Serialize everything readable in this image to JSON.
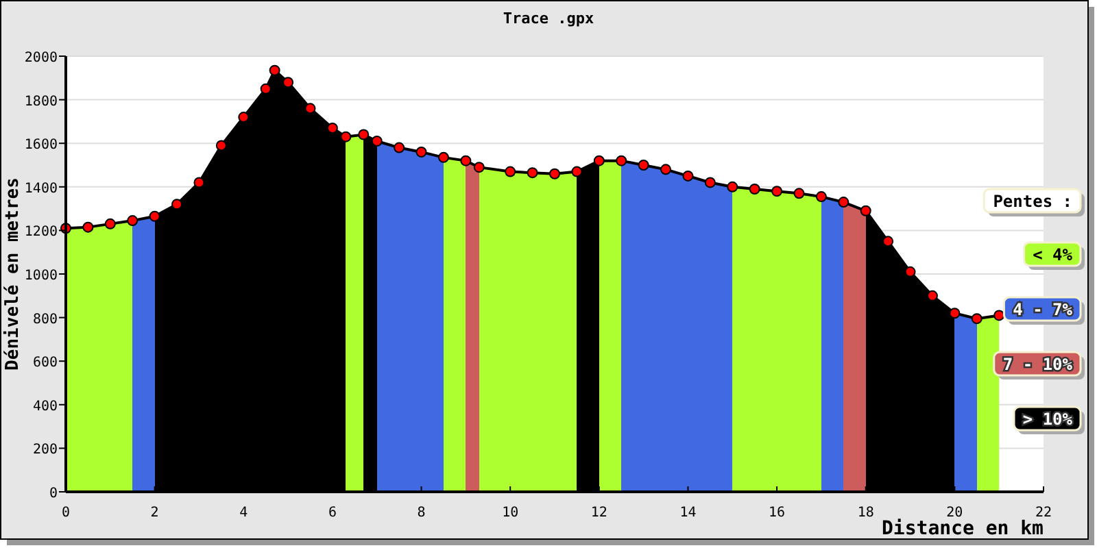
{
  "chart": {
    "chart_data": {
      "type": "area",
      "title": "Trace .gpx",
      "xlabel": "Distance en km",
      "ylabel": "Dénivelé en metres",
      "x": [
        0,
        0.5,
        1,
        1.5,
        2,
        2.5,
        3,
        3.5,
        4,
        4.5,
        4.7,
        5,
        5.5,
        6,
        6.3,
        6.7,
        7,
        7.5,
        8,
        8.5,
        9,
        9.3,
        10,
        10.5,
        11,
        11.5,
        12,
        12.5,
        13,
        13.5,
        14,
        14.5,
        15,
        15.5,
        16,
        16.5,
        17,
        17.5,
        18,
        18.5,
        19,
        19.5,
        20,
        20.5,
        21
      ],
      "series": [
        {
          "color": "#ff0000",
          "values": [
            1210,
            1215,
            1230,
            1245,
            1265,
            1320,
            1420,
            1590,
            1720,
            1850,
            1935,
            1880,
            1760,
            1670,
            1630,
            1640,
            1610,
            1580,
            1560,
            1535,
            1520,
            1490,
            1470,
            1465,
            1460,
            1470,
            1520,
            1520,
            1500,
            1480,
            1450,
            1420,
            1400,
            1390,
            1380,
            1370,
            1355,
            1330,
            1290,
            1150,
            1010,
            900,
            820,
            795,
            810
          ]
        }
      ],
      "grid": true,
      "xlim": [
        0,
        22
      ],
      "ylim": [
        0,
        2000
      ],
      "xticks": [
        0,
        2,
        4,
        6,
        8,
        10,
        12,
        14,
        16,
        18,
        20,
        22
      ],
      "yticks": [
        0,
        200,
        400,
        600,
        800,
        1000,
        1200,
        1400,
        1600,
        1800,
        2000
      ]
    },
    "legend": {
      "title": "Pentes :",
      "items": [
        {
          "label": "< 4%",
          "color": "#adff2f"
        },
        {
          "label": "4 - 7%",
          "color": "#4169e1"
        },
        {
          "label": "7 - 10%",
          "color": "#cd5c5c"
        },
        {
          "label": "> 10%",
          "color": "#000000"
        }
      ]
    }
  }
}
